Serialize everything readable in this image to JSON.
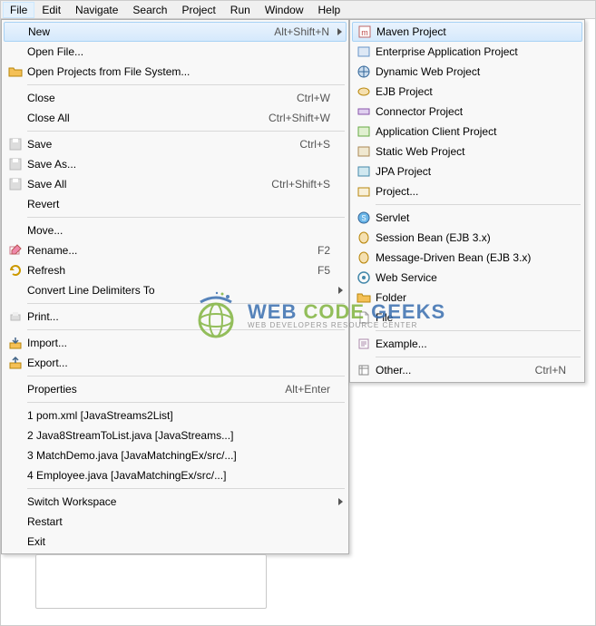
{
  "menubar": [
    "File",
    "Edit",
    "Navigate",
    "Search",
    "Project",
    "Run",
    "Window",
    "Help"
  ],
  "fileMenu": {
    "groups": [
      [
        {
          "label": "New",
          "shortcut": "Alt+Shift+N",
          "submenu": true,
          "highlight": true,
          "icon": "blank"
        },
        {
          "label": "Open File...",
          "icon": "blank"
        },
        {
          "label": "Open Projects from File System...",
          "icon": "folder-open"
        }
      ],
      [
        {
          "label": "Close",
          "shortcut": "Ctrl+W",
          "icon": "blank"
        },
        {
          "label": "Close All",
          "shortcut": "Ctrl+Shift+W",
          "icon": "blank"
        }
      ],
      [
        {
          "label": "Save",
          "shortcut": "Ctrl+S",
          "icon": "save-disabled"
        },
        {
          "label": "Save As...",
          "icon": "save-disabled"
        },
        {
          "label": "Save All",
          "shortcut": "Ctrl+Shift+S",
          "icon": "save-disabled"
        },
        {
          "label": "Revert",
          "icon": "blank"
        }
      ],
      [
        {
          "label": "Move...",
          "icon": "blank"
        },
        {
          "label": "Rename...",
          "shortcut": "F2",
          "icon": "rename"
        },
        {
          "label": "Refresh",
          "shortcut": "F5",
          "icon": "refresh"
        },
        {
          "label": "Convert Line Delimiters To",
          "submenu": true,
          "icon": "blank"
        }
      ],
      [
        {
          "label": "Print...",
          "icon": "print-disabled"
        }
      ],
      [
        {
          "label": "Import...",
          "icon": "import"
        },
        {
          "label": "Export...",
          "icon": "export"
        }
      ],
      [
        {
          "label": "Properties",
          "shortcut": "Alt+Enter",
          "icon": "blank"
        }
      ],
      [
        {
          "label": "1 pom.xml  [JavaStreams2List]",
          "icon": "blank"
        },
        {
          "label": "2 Java8StreamToList.java  [JavaStreams...]",
          "icon": "blank"
        },
        {
          "label": "3 MatchDemo.java  [JavaMatchingEx/src/...]",
          "icon": "blank"
        },
        {
          "label": "4 Employee.java  [JavaMatchingEx/src/...]",
          "icon": "blank"
        }
      ],
      [
        {
          "label": "Switch Workspace",
          "submenu": true,
          "icon": "blank"
        },
        {
          "label": "Restart",
          "icon": "blank"
        },
        {
          "label": "Exit",
          "icon": "blank"
        }
      ]
    ]
  },
  "newMenu": {
    "groups": [
      [
        {
          "label": "Maven Project",
          "highlight": true,
          "icon": "maven"
        },
        {
          "label": "Enterprise Application Project",
          "icon": "ear"
        },
        {
          "label": "Dynamic Web Project",
          "icon": "web"
        },
        {
          "label": "EJB Project",
          "icon": "ejb"
        },
        {
          "label": "Connector Project",
          "icon": "connector"
        },
        {
          "label": "Application Client Project",
          "icon": "appclient"
        },
        {
          "label": "Static Web Project",
          "icon": "staticweb"
        },
        {
          "label": "JPA Project",
          "icon": "jpa"
        },
        {
          "label": "Project...",
          "icon": "project"
        }
      ],
      [
        {
          "label": "Servlet",
          "icon": "servlet"
        },
        {
          "label": "Session Bean (EJB 3.x)",
          "icon": "bean"
        },
        {
          "label": "Message-Driven Bean (EJB 3.x)",
          "icon": "bean"
        },
        {
          "label": "Web Service",
          "icon": "webservice"
        },
        {
          "label": "Folder",
          "icon": "folder"
        },
        {
          "label": "File",
          "icon": "file"
        }
      ],
      [
        {
          "label": "Example...",
          "icon": "example"
        }
      ],
      [
        {
          "label": "Other...",
          "shortcut": "Ctrl+N",
          "icon": "other"
        }
      ]
    ]
  },
  "watermark": {
    "title_parts": [
      "WEB ",
      "CODE",
      " GEEKS"
    ],
    "subtitle": "WEB DEVELOPERS RESOURCE CENTER"
  }
}
